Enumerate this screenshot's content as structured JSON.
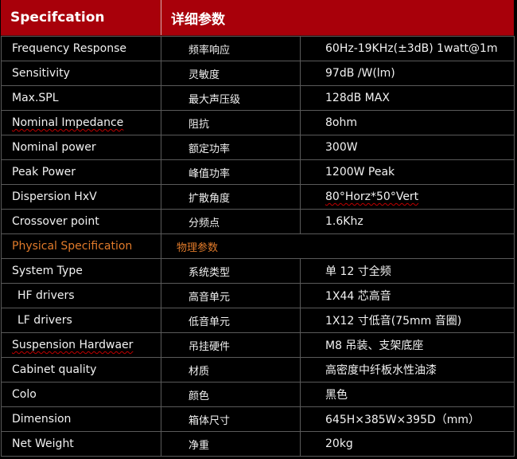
{
  "header": {
    "col1": "Specifcation",
    "col2": "详细参数"
  },
  "rows": [
    {
      "en": "Frequency Response",
      "cn": "频率响应",
      "val": "60Hz-19KHz(±3dB) 1watt@1m"
    },
    {
      "en": "Sensitivity",
      "cn": "灵敏度",
      "val": "97dB /W(lm)"
    },
    {
      "en": "Max.SPL",
      "cn": "最大声压级",
      "val": "128dB MAX"
    },
    {
      "en": "Nominal Impedance",
      "cn": "阻抗",
      "val": "8ohm"
    },
    {
      "en": "Nominal power",
      "cn": "额定功率",
      "val": "300W"
    },
    {
      "en": "Peak Power",
      "cn": "峰值功率",
      "val": "1200W Peak"
    },
    {
      "en": "Dispersion HxV",
      "cn": "扩散角度",
      "val": "80°Horz*50°Vert"
    },
    {
      "en": "Crossover point",
      "cn": "分频点",
      "val": "1.6Khz"
    }
  ],
  "section": {
    "en": "Physical Specification",
    "cn": "物理参数"
  },
  "rows2": [
    {
      "en": "System Type",
      "cn": "系统类型",
      "val": "单 12 寸全频"
    },
    {
      "en": "HF drivers",
      "cn": "高音单元",
      "val": "1X44 芯高音"
    },
    {
      "en": "LF drivers",
      "cn": "低音单元",
      "val": "1X12 寸低音(75mm 音圈)"
    },
    {
      "en": "Suspension Hardwaer",
      "cn": "吊挂硬件",
      "val": "M8 吊装、支架底座"
    },
    {
      "en": "Cabinet quality",
      "cn": "材质",
      "val": "高密度中纤板水性油漆"
    },
    {
      "en": "Colo",
      "cn": "颜色",
      "val": "黑色"
    },
    {
      "en": "Dimension",
      "cn": "箱体尺寸",
      "val": "645H×385W×395D（mm）"
    },
    {
      "en": "Net Weight",
      "cn": "净重",
      "val": "20kg"
    }
  ]
}
